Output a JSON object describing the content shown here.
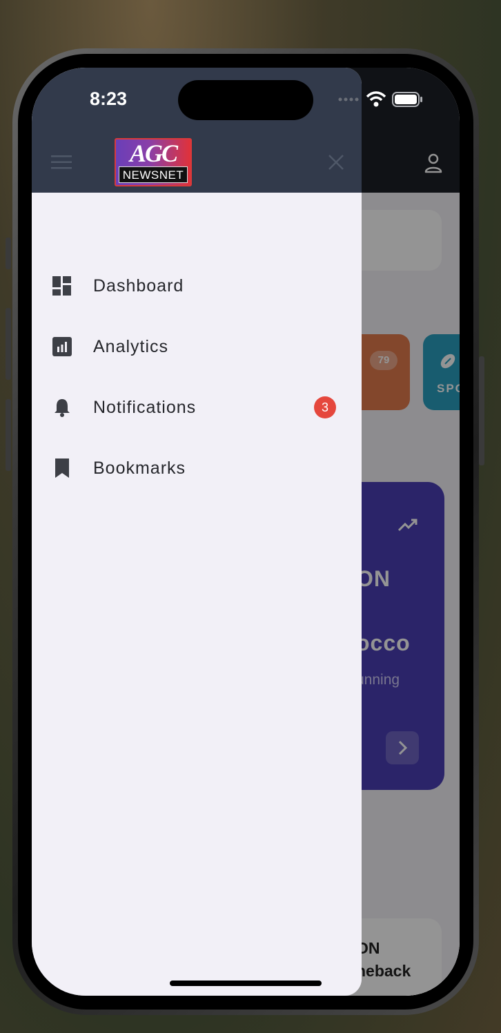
{
  "status_bar": {
    "time": "8:23"
  },
  "drawer": {
    "logo": {
      "top_text": "AGC",
      "bottom_text": "NEWSNET"
    },
    "nav_items": [
      {
        "label": "Dashboard",
        "icon": "dashboard-icon"
      },
      {
        "label": "Analytics",
        "icon": "analytics-icon"
      },
      {
        "label": "Notifications",
        "icon": "bell-icon",
        "badge": "3"
      },
      {
        "label": "Bookmarks",
        "icon": "bookmark-icon"
      }
    ]
  },
  "background": {
    "category_count": "79",
    "category_label": "SPO",
    "featured_line1": "ON",
    "featured_line2": "occo",
    "featured_line3": "unning",
    "bottom_line1": "ON",
    "bottom_line2": "neback"
  },
  "colors": {
    "drawer_header": "#323a4b",
    "drawer_bg": "#f2f0f7",
    "badge": "#e5473d",
    "featured_card": "#4a3fb5"
  }
}
